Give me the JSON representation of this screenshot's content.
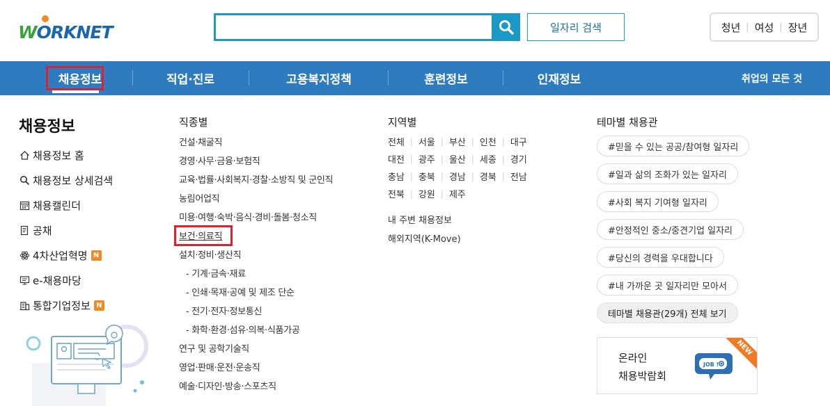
{
  "header": {
    "logo_text_w": "W",
    "logo_text_rest": "ORKNET",
    "search_placeholder": "",
    "search_value": "",
    "job_search_label": "일자리 검색",
    "targets": [
      "청년",
      "여성",
      "장년"
    ]
  },
  "nav": {
    "items": [
      "채용정보",
      "직업·진로",
      "고용복지정책",
      "훈련정보",
      "인재정보"
    ],
    "all_label": "취업의 모든 것"
  },
  "left": {
    "title": "채용정보",
    "menu": [
      {
        "label": "채용정보 홈",
        "icon": "home-icon"
      },
      {
        "label": "채용정보 상세검색",
        "icon": "search-icon"
      },
      {
        "label": "채용캘린더",
        "icon": "calendar-icon"
      },
      {
        "label": "공채",
        "icon": "document-icon"
      },
      {
        "label": "4차산업혁명",
        "icon": "atom-icon",
        "badge": "N"
      },
      {
        "label": "e-채용마당",
        "icon": "monitor-icon"
      },
      {
        "label": "통합기업정보",
        "icon": "building-icon",
        "badge": "N"
      }
    ]
  },
  "jobs": {
    "title": "직종별",
    "items": [
      "건설·채굴직",
      "경영·사무·금융·보험직",
      "교육·법률·사회복지·경찰·소방직 및 군인직",
      "농림어업직",
      "미용·여행·숙박·음식·경비·돌봄·청소직",
      "보건·의료직",
      "설치·정비·생산직",
      "- 기계·금속·재료",
      "- 인쇄·목재·공예 및 제조 단순",
      "- 전기·전자·정보통신",
      "- 화학·환경·섬유·의복·식품가공",
      "연구 및 공학기술직",
      "영업·판매·운전·운송직",
      "예술·디자인·방송·스포츠직"
    ]
  },
  "regions": {
    "title": "지역별",
    "rows": [
      [
        "전체",
        "서울",
        "부산",
        "인천",
        "대구"
      ],
      [
        "대전",
        "광주",
        "울산",
        "세종",
        "경기"
      ],
      [
        "충남",
        "충북",
        "경남",
        "경북",
        "전남"
      ],
      [
        "전북",
        "강원",
        "제주"
      ]
    ],
    "nearby": "내 주변 채용정보",
    "overseas": "해외지역(K-Move)"
  },
  "themes": {
    "title": "테마별 채용관",
    "tags": [
      "#믿을 수 있는 공공/참여형 일자리",
      "#일과 삶의 조화가 있는 일자리",
      "#사회 복지 기여형 일자리",
      "#안정적인 중소/중견기업 일자리",
      "#당신의 경력을 우대합니다",
      "#내 가까운 곳 일자리만 모아서"
    ],
    "all_label": "테마별 채용관(29개) 전체 보기"
  },
  "fair": {
    "line1": "온라인",
    "line2": "채용박람회",
    "ribbon": "NEW",
    "bubble_text": "JOB !"
  },
  "colors": {
    "nav_bg": "#2e7bbf",
    "accent": "#1a98c6",
    "highlight": "#e0202a",
    "badge": "#f08a24"
  }
}
